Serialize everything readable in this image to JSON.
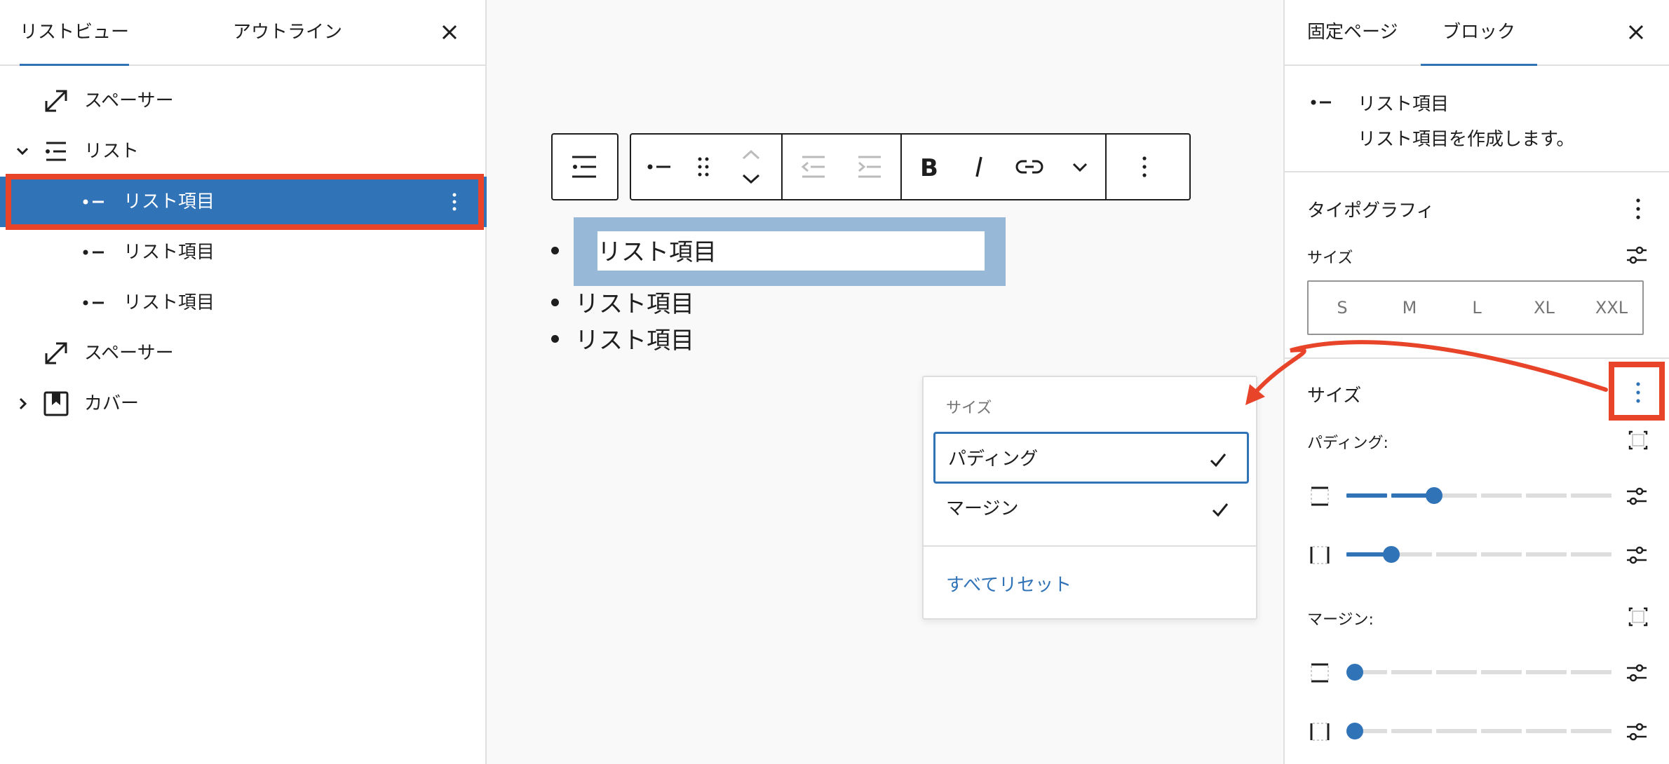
{
  "left_panel": {
    "tabs": [
      {
        "label": "リストビュー"
      },
      {
        "label": "アウトライン"
      }
    ],
    "tree": [
      {
        "label": "スペーサー",
        "icon": "spacer-icon"
      },
      {
        "label": "リスト",
        "icon": "list-icon"
      },
      {
        "label": "リスト項目",
        "icon": "list-item-icon"
      },
      {
        "label": "リスト項目",
        "icon": "list-item-icon"
      },
      {
        "label": "リスト項目",
        "icon": "list-item-icon"
      },
      {
        "label": "スペーサー",
        "icon": "spacer-icon"
      },
      {
        "label": "カバー",
        "icon": "cover-icon"
      }
    ]
  },
  "canvas": {
    "list_items": [
      "リスト項目",
      "リスト項目",
      "リスト項目"
    ]
  },
  "dropdown": {
    "heading": "サイズ",
    "options": [
      {
        "label": "パディング",
        "checked": true
      },
      {
        "label": "マージン",
        "checked": true
      }
    ],
    "reset_label": "すべてリセット"
  },
  "right_panel": {
    "tabs": [
      {
        "label": "固定ページ"
      },
      {
        "label": "ブロック"
      }
    ],
    "block": {
      "name": "リスト項目",
      "description": "リスト項目を作成します。"
    },
    "typography": {
      "title": "タイポグラフィ",
      "size_label": "サイズ",
      "size_options": [
        "S",
        "M",
        "L",
        "XL",
        "XXL"
      ]
    },
    "dimensions": {
      "title": "サイズ",
      "padding_label": "パディング:",
      "margin_label": "マージン:",
      "padding_values": [
        0.33,
        0.17
      ],
      "margin_values": [
        0.0,
        0.0
      ]
    },
    "colors": {
      "accent": "#3173b7",
      "highlight": "#e8442a"
    }
  }
}
